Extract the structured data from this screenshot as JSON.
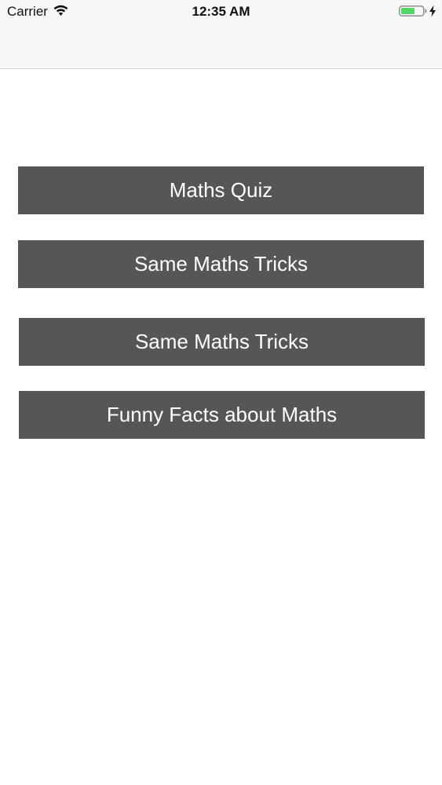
{
  "status_bar": {
    "carrier": "Carrier",
    "time": "12:35 AM",
    "wifi_icon": "wifi-icon",
    "battery_icon": "battery-icon",
    "charging_icon": "bolt-icon",
    "battery_color": "#4cd964"
  },
  "menu": {
    "button_color": "#585557",
    "text_color": "#ffffff",
    "buttons": [
      {
        "label": "Maths Quiz"
      },
      {
        "label": "Same Maths Tricks"
      },
      {
        "label": "Same Maths Tricks"
      },
      {
        "label": "Funny Facts about Maths"
      }
    ]
  }
}
